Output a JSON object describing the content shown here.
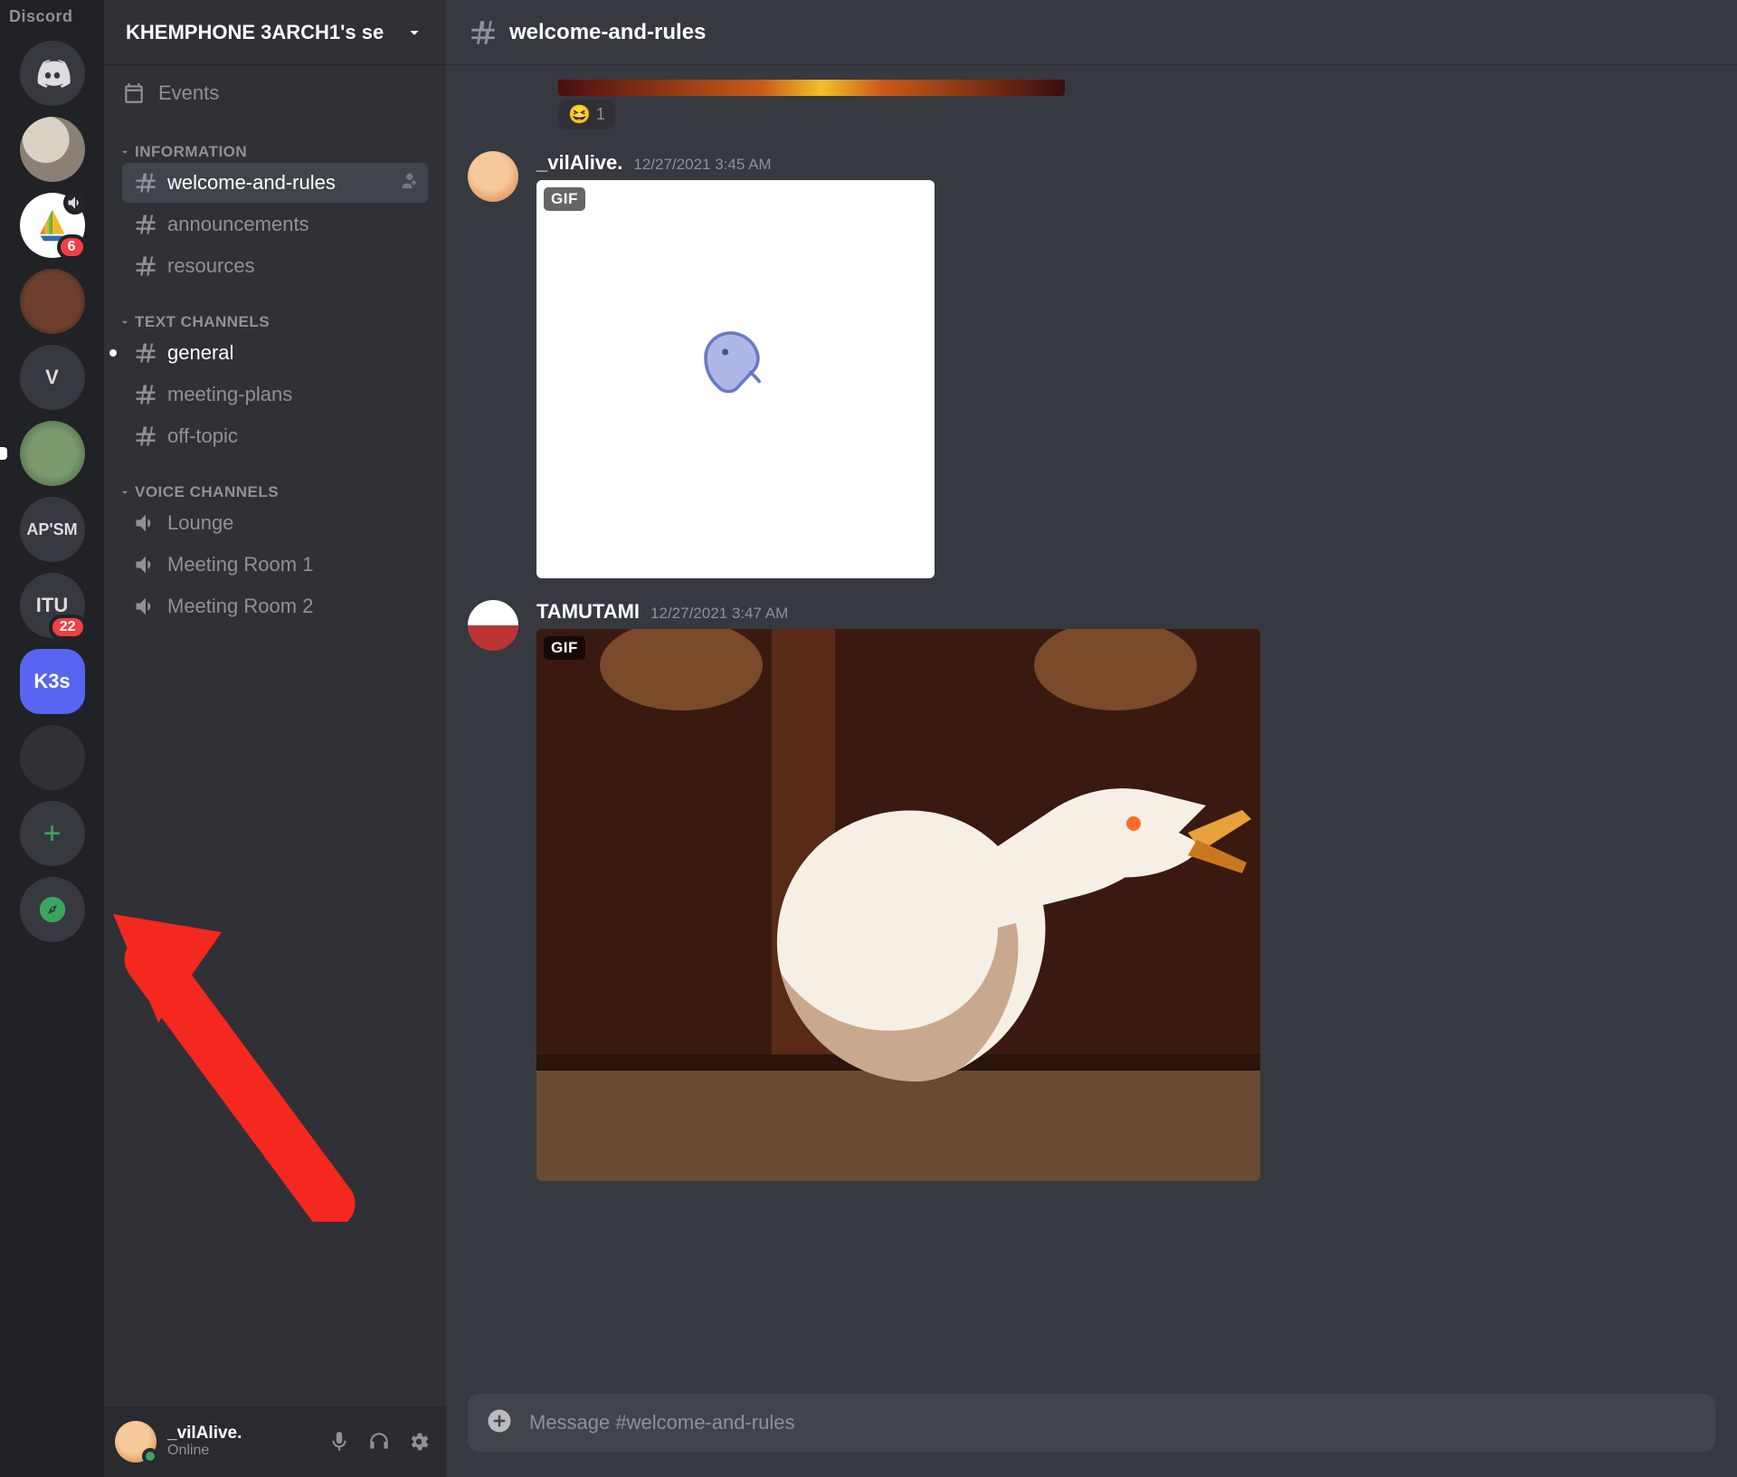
{
  "wordmark": "Discord",
  "servers": [
    {
      "kind": "home"
    },
    {
      "kind": "img",
      "style": "av-photo"
    },
    {
      "kind": "img",
      "style": "av-sail",
      "badge": "6",
      "speaker": true
    },
    {
      "kind": "img",
      "style": "av-room"
    },
    {
      "kind": "text",
      "label": "V",
      "style": "av-letter"
    },
    {
      "kind": "img",
      "style": "av-plant",
      "unread": true
    },
    {
      "kind": "text",
      "label": "AP'SM",
      "style": "av-letter",
      "small": true
    },
    {
      "kind": "text",
      "label": "ITU",
      "style": "av-letter",
      "badge": "22"
    },
    {
      "kind": "text",
      "label": "K3s",
      "active": true
    },
    {
      "kind": "blank"
    },
    {
      "kind": "add"
    },
    {
      "kind": "discover"
    }
  ],
  "server_header": "KHEMPHONE 3ARCH1's se",
  "events_label": "Events",
  "categories": [
    {
      "name": "INFORMATION",
      "channels": [
        {
          "name": "welcome-and-rules",
          "type": "text",
          "active": true,
          "invite": true
        },
        {
          "name": "announcements",
          "type": "text"
        },
        {
          "name": "resources",
          "type": "text"
        }
      ]
    },
    {
      "name": "TEXT CHANNELS",
      "channels": [
        {
          "name": "general",
          "type": "text",
          "unread": true
        },
        {
          "name": "meeting-plans",
          "type": "text"
        },
        {
          "name": "off-topic",
          "type": "text"
        }
      ]
    },
    {
      "name": "VOICE CHANNELS",
      "channels": [
        {
          "name": "Lounge",
          "type": "voice"
        },
        {
          "name": "Meeting Room 1",
          "type": "voice"
        },
        {
          "name": "Meeting Room 2",
          "type": "voice"
        }
      ]
    }
  ],
  "current_channel": "welcome-and-rules",
  "reaction": {
    "emoji": "😆",
    "count": "1"
  },
  "messages": [
    {
      "author": "_vilAlive.",
      "time": "12/27/2021 3:45 AM",
      "gif": "bird",
      "avatar": "av-bird"
    },
    {
      "author": "TAMUTAMI",
      "time": "12/27/2021 3:47 AM",
      "gif": "seagull",
      "avatar": "av-tamu"
    }
  ],
  "gif_tag": "GIF",
  "composer_placeholder": "Message #welcome-and-rules",
  "user": {
    "name": "_vilAlive.",
    "status": "Online"
  }
}
